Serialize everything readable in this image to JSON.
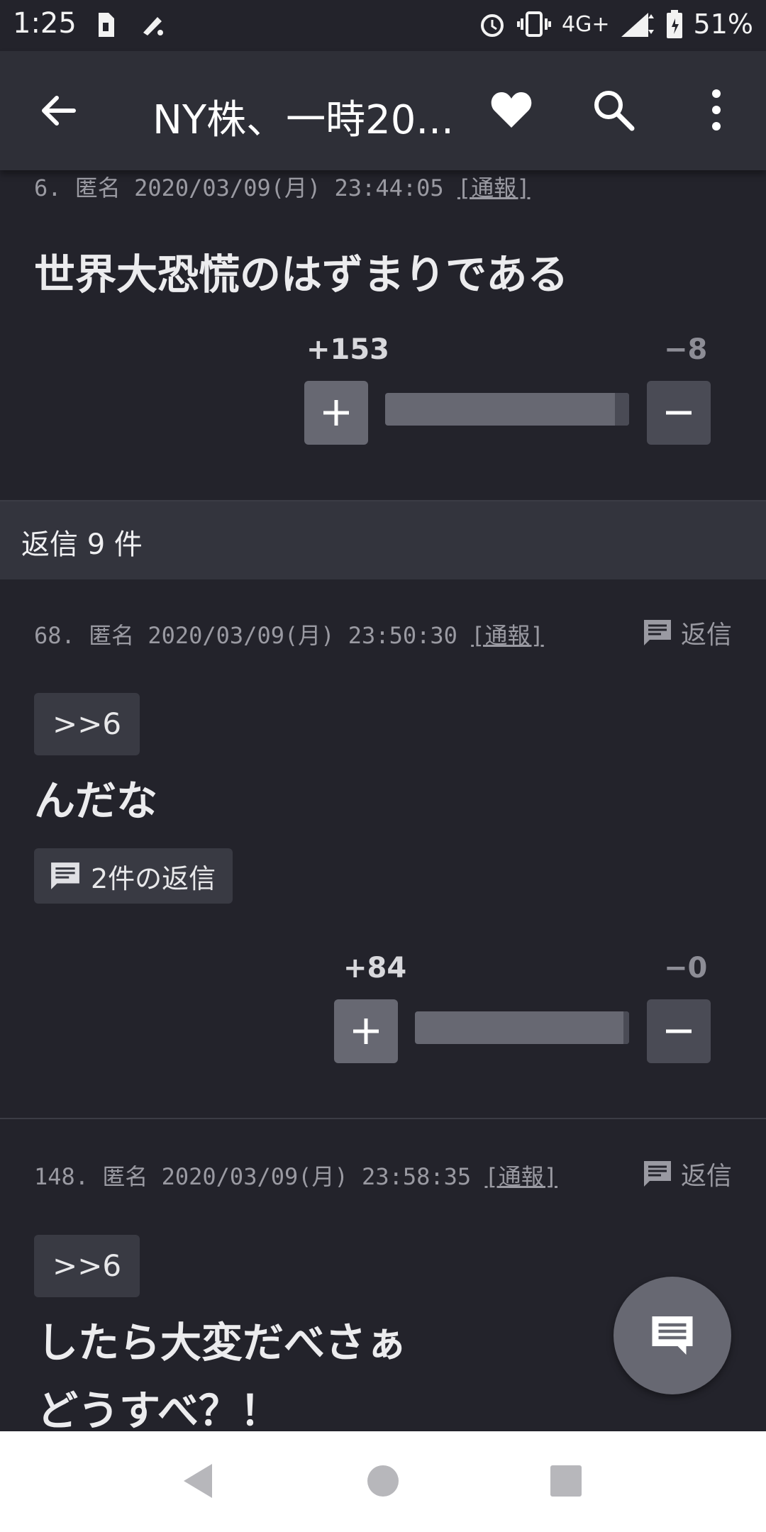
{
  "status_bar": {
    "time": "1:25",
    "network": "4G+",
    "battery": "51%",
    "icons": [
      "sim-icon",
      "cast-icon",
      "alarm-icon",
      "vibrate-icon",
      "signal-icon",
      "battery-icon"
    ]
  },
  "app_bar": {
    "title": "NY株、一時20...",
    "icons": [
      "back-arrow-icon",
      "heart-icon",
      "search-icon",
      "more-vert-icon"
    ]
  },
  "main_post": {
    "meta": "6. 匿名 2020/03/09(月) 23:44:05",
    "report_label": "[通報]",
    "text": "世界大恐慌のはずまりである",
    "plus_count": "+153",
    "minus_count": "−8",
    "plus_ratio": 0.95
  },
  "reply_header": "返信 9 件",
  "replies": [
    {
      "meta": "68. 匿名 2020/03/09(月) 23:50:30",
      "report_label": "[通報]",
      "reply_label": "返信",
      "anchor": ">>6",
      "text": "んだな",
      "replies_count_label": "2件の返信",
      "plus_count": "+84",
      "minus_count": "−0",
      "plus_ratio": 0.99
    },
    {
      "meta": "148. 匿名 2020/03/09(月) 23:58:35",
      "report_label": "[通報]",
      "reply_label": "返信",
      "anchor": ">>6",
      "text_line1": "したら大変だべさぁ",
      "text_line2": "どうすべ？！"
    }
  ],
  "colors": {
    "background": "#23232b",
    "app_bar": "#2e2f37",
    "plus_button": "#676872",
    "minus_button": "#4a4b55"
  }
}
